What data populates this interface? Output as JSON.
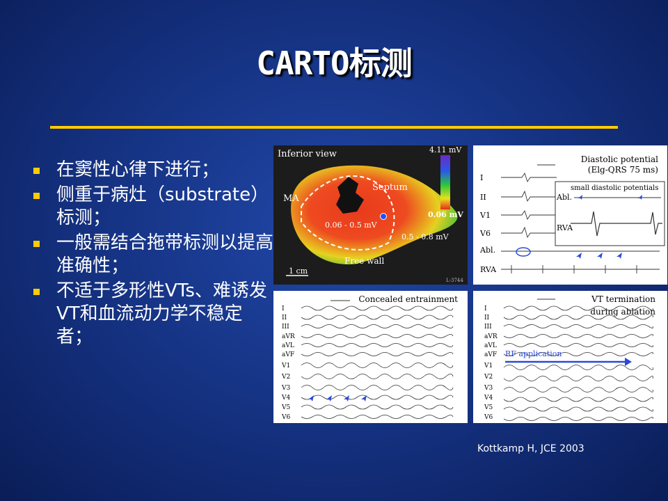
{
  "slide": {
    "title": "CARTO标测",
    "bullets": [
      "在窦性心律下进行；",
      "侧重于病灶（substrate）标测；",
      "一般需结合拖带标测以提高准确性；",
      "不适于多形性VTs、难诱发VT和血流动力学不稳定者；"
    ],
    "citation": "Kottkamp H, JCE 2003"
  },
  "colors": {
    "accent": "#ffcc00",
    "background": "#14307e",
    "text": "#ffffff"
  },
  "map_panel": {
    "view_label": "Inferior view",
    "scale_max": "4.11 mV",
    "scale_min": "0.06 mV",
    "label_ma": "MA",
    "label_septum": "Septum",
    "label_zone1": "0.06 - 0.5 mV",
    "label_zone2": "0.5 - 0.8 mV",
    "label_free_wall": "Free wall",
    "scale_bar": "1 cm",
    "code": "L-3744"
  },
  "diastolic_panel": {
    "title1": "Diastolic potential",
    "title2": "(Elg-QRS 75 ms)",
    "inset_title": "small diastolic potentials",
    "inset_abl": "Abl.",
    "inset_rva": "RVA",
    "leads": [
      "I",
      "II",
      "V1",
      "V6",
      "Abl.",
      "RVA"
    ]
  },
  "entrainment_panel": {
    "title": "Concealed entrainment",
    "leads": [
      "I",
      "II",
      "III",
      "aVR",
      "aVL",
      "aVF",
      "V1",
      "V2",
      "V3",
      "V4",
      "V5",
      "V6"
    ]
  },
  "termination_panel": {
    "title1": "VT termination",
    "title2": "during ablation",
    "rf_label": "RF application",
    "leads": [
      "I",
      "II",
      "III",
      "aVR",
      "aVL",
      "aVF",
      "V1",
      "V2",
      "V3",
      "V4",
      "V5",
      "V6"
    ]
  }
}
